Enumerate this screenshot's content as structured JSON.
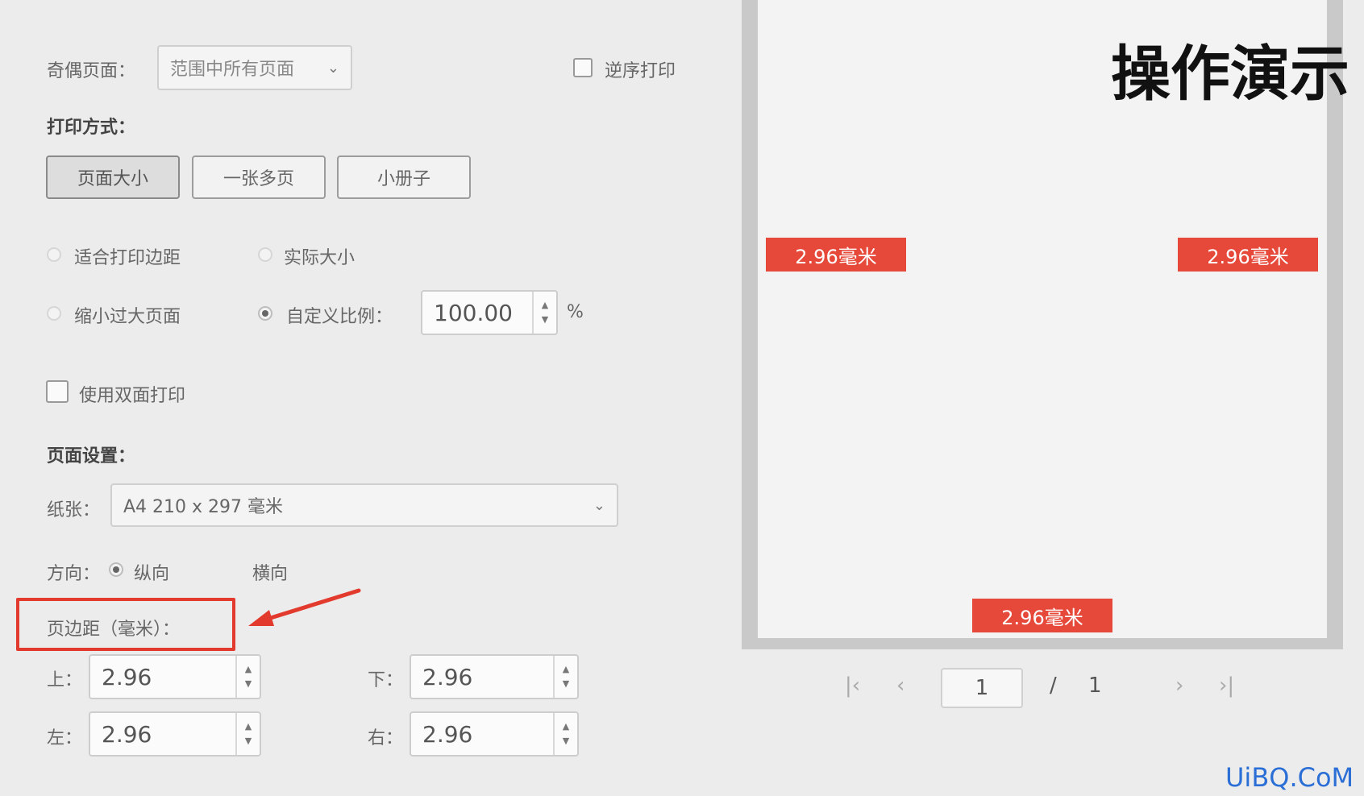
{
  "odd_even": {
    "label": "奇偶页面：",
    "value": "范围中所有页面"
  },
  "reverse_print": {
    "label": "逆序打印"
  },
  "print_mode": {
    "label": "打印方式：",
    "buttons": [
      "页面大小",
      "一张多页",
      "小册子"
    ]
  },
  "scale": {
    "fit_margins": "适合打印边距",
    "actual_size": "实际大小",
    "shrink_large": "缩小过大页面",
    "custom_ratio": "自定义比例：",
    "ratio_value": "100.00",
    "ratio_unit": "%"
  },
  "duplex": {
    "label": "使用双面打印"
  },
  "page_setup": {
    "label": "页面设置：",
    "paper_label": "纸张：",
    "paper_value": "A4 210 x 297 毫米",
    "orientation_label": "方向：",
    "portrait": "纵向",
    "landscape": "横向"
  },
  "margins": {
    "label": "页边距（毫米）：",
    "top_label": "上：",
    "top_value": "2.96",
    "bottom_label": "下：",
    "bottom_value": "2.96",
    "left_label": "左：",
    "left_value": "2.96",
    "right_label": "右：",
    "right_value": "2.96"
  },
  "preview": {
    "heading": "操作演示",
    "tag_left": "2.96毫米",
    "tag_right": "2.96毫米",
    "tag_bottom": "2.96毫米"
  },
  "pager": {
    "current": "1",
    "separator": "/",
    "total": "1"
  },
  "watermark": "UiBQ.CoM",
  "colors": {
    "accent_red": "#e6493a"
  }
}
